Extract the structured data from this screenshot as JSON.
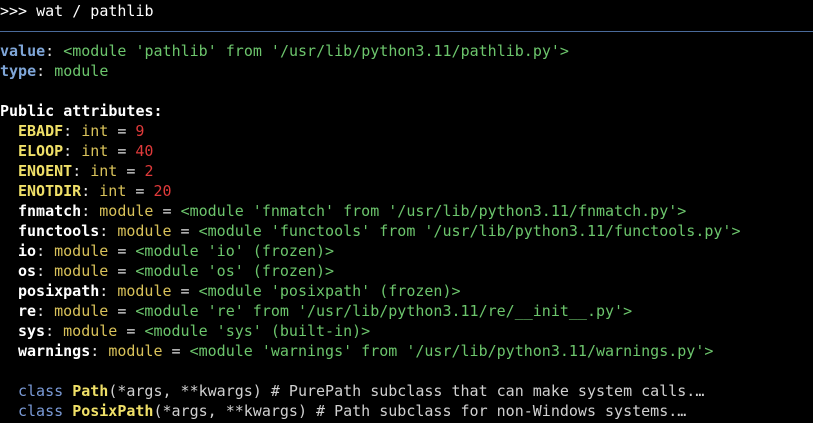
{
  "terminal": {
    "prompt": ">>> ",
    "command": "wat / pathlib"
  },
  "summary": {
    "value_label": "value",
    "value_text": "<module 'pathlib' from '/usr/lib/python3.11/pathlib.py'>",
    "type_label": "type",
    "type_text": "module"
  },
  "public_attributes_heading": "Public attributes:",
  "attributes": [
    {
      "name": "EBADF",
      "type": "int",
      "value": "9",
      "name_style": "yellow-bold",
      "value_style": "red"
    },
    {
      "name": "ELOOP",
      "type": "int",
      "value": "40",
      "name_style": "yellow-bold",
      "value_style": "red"
    },
    {
      "name": "ENOENT",
      "type": "int",
      "value": "2",
      "name_style": "yellow-bold",
      "value_style": "red"
    },
    {
      "name": "ENOTDIR",
      "type": "int",
      "value": "20",
      "name_style": "yellow-bold",
      "value_style": "red"
    },
    {
      "name": "fnmatch",
      "type": "module",
      "value": "<module 'fnmatch' from '/usr/lib/python3.11/fnmatch.py'>",
      "name_style": "white-bold",
      "value_style": "green"
    },
    {
      "name": "functools",
      "type": "module",
      "value": "<module 'functools' from '/usr/lib/python3.11/functools.py'>",
      "name_style": "white-bold",
      "value_style": "green"
    },
    {
      "name": "io",
      "type": "module",
      "value": "<module 'io' (frozen)>",
      "name_style": "white-bold",
      "value_style": "green"
    },
    {
      "name": "os",
      "type": "module",
      "value": "<module 'os' (frozen)>",
      "name_style": "white-bold",
      "value_style": "green"
    },
    {
      "name": "posixpath",
      "type": "module",
      "value": "<module 'posixpath' (frozen)>",
      "name_style": "white-bold",
      "value_style": "green"
    },
    {
      "name": "re",
      "type": "module",
      "value": "<module 're' from '/usr/lib/python3.11/re/__init__.py'>",
      "name_style": "white-bold",
      "value_style": "green"
    },
    {
      "name": "sys",
      "type": "module",
      "value": "<module 'sys' (built-in)>",
      "name_style": "white-bold",
      "value_style": "green"
    },
    {
      "name": "warnings",
      "type": "module",
      "value": "<module 'warnings' from '/usr/lib/python3.11/warnings.py'>",
      "name_style": "white-bold",
      "value_style": "green"
    }
  ],
  "classes": [
    {
      "keyword": "class",
      "name": "Path",
      "signature": "(*args, **kwargs)",
      "comment": " # PurePath subclass that can make system calls.…"
    },
    {
      "keyword": "class",
      "name": "PosixPath",
      "signature": "(*args, **kwargs)",
      "comment": " # Path subclass for non-Windows systems.…"
    }
  ],
  "colors": {
    "background": "#000000",
    "separator": "#4a6a9a",
    "label_blue": "#7fa6d8",
    "string_green": "#6cc56c",
    "name_yellow": "#f0e068",
    "type_yellow": "#d9c25a",
    "number_red": "#e03a3a"
  }
}
